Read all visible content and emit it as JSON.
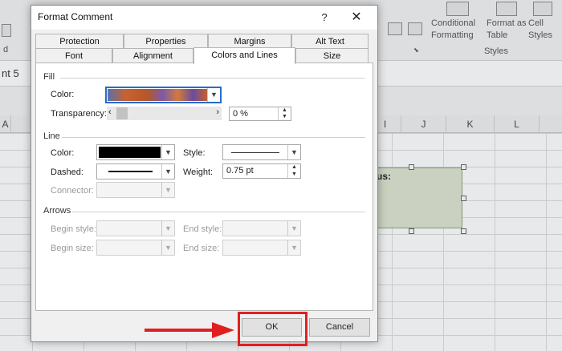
{
  "excel": {
    "ribbon": {
      "conditional_formatting": "Conditional\nFormatting",
      "format_as_table": "Format as\nTable",
      "cell_styles": "Cell\nStyles",
      "styles_group": "Styles",
      "dropdown_arrow": "˅",
      "d_label": "d"
    },
    "name_box": "nt 5",
    "columns": [
      "A",
      "I",
      "J",
      "K",
      "L"
    ],
    "comment_text": "us:"
  },
  "dialog": {
    "title": "Format Comment",
    "help": "?",
    "close": "✕",
    "tabs_row1": [
      "Protection",
      "Properties",
      "Margins",
      "Alt Text"
    ],
    "tabs_row2": [
      "Font",
      "Alignment",
      "Colors and Lines",
      "Size"
    ],
    "active_tab": "Colors and Lines",
    "fill": {
      "section": "Fill",
      "color_label": "Color:",
      "transparency_label": "Transparency:",
      "transparency_value": "0 %",
      "transparency_level": 0
    },
    "line": {
      "section": "Line",
      "color_label": "Color:",
      "color_value": "#000000",
      "dashed_label": "Dashed:",
      "connector_label": "Connector:",
      "style_label": "Style:",
      "weight_label": "Weight:",
      "weight_value": "0.75 pt"
    },
    "arrows": {
      "section": "Arrows",
      "begin_style": "Begin style:",
      "begin_size": "Begin size:",
      "end_style": "End style:",
      "end_size": "End size:"
    },
    "ok": "OK",
    "cancel": "Cancel"
  },
  "colors": {
    "highlight": "#e02020",
    "fill_swatch": "#c8622e"
  }
}
